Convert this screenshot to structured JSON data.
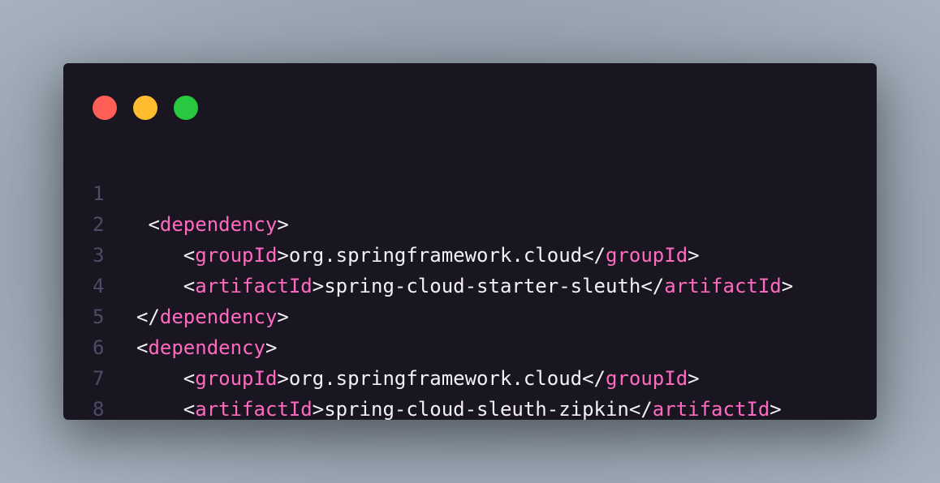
{
  "window": {
    "controls": [
      {
        "name": "close",
        "color": "#ff5f57"
      },
      {
        "name": "minimize",
        "color": "#febc2e"
      },
      {
        "name": "maximize",
        "color": "#28c840"
      }
    ]
  },
  "colors": {
    "tag": "#ff6ac1",
    "text": "#f3f1f5",
    "line_number": "#4f4a66",
    "background": "#1a1621"
  },
  "code": {
    "lines": [
      {
        "number": "1",
        "indent": " ",
        "open": "<",
        "tag": "dependency",
        "close": ">",
        "text": "",
        "end_open": "",
        "end_tag": "",
        "end_close": ""
      },
      {
        "number": "2",
        "indent": "    ",
        "open": "<",
        "tag": "groupId",
        "close": ">",
        "text": "org.springframework.cloud",
        "end_open": "</",
        "end_tag": "groupId",
        "end_close": ">"
      },
      {
        "number": "3",
        "indent": "    ",
        "open": "<",
        "tag": "artifactId",
        "close": ">",
        "text": "spring-cloud-starter-sleuth",
        "end_open": "</",
        "end_tag": "artifactId",
        "end_close": ">"
      },
      {
        "number": "4",
        "indent": "",
        "open": "</",
        "tag": "dependency",
        "close": ">",
        "text": "",
        "end_open": "",
        "end_tag": "",
        "end_close": ""
      },
      {
        "number": "5",
        "indent": "",
        "open": "<",
        "tag": "dependency",
        "close": ">",
        "text": "",
        "end_open": "",
        "end_tag": "",
        "end_close": ""
      },
      {
        "number": "6",
        "indent": "    ",
        "open": "<",
        "tag": "groupId",
        "close": ">",
        "text": "org.springframework.cloud",
        "end_open": "</",
        "end_tag": "groupId",
        "end_close": ">"
      },
      {
        "number": "7",
        "indent": "    ",
        "open": "<",
        "tag": "artifactId",
        "close": ">",
        "text": "spring-cloud-sleuth-zipkin",
        "end_open": "</",
        "end_tag": "artifactId",
        "end_close": ">"
      },
      {
        "number": "8",
        "indent": "",
        "open": "</",
        "tag": "dependency",
        "close": ">",
        "text": "",
        "end_open": "",
        "end_tag": "",
        "end_close": ""
      }
    ]
  }
}
